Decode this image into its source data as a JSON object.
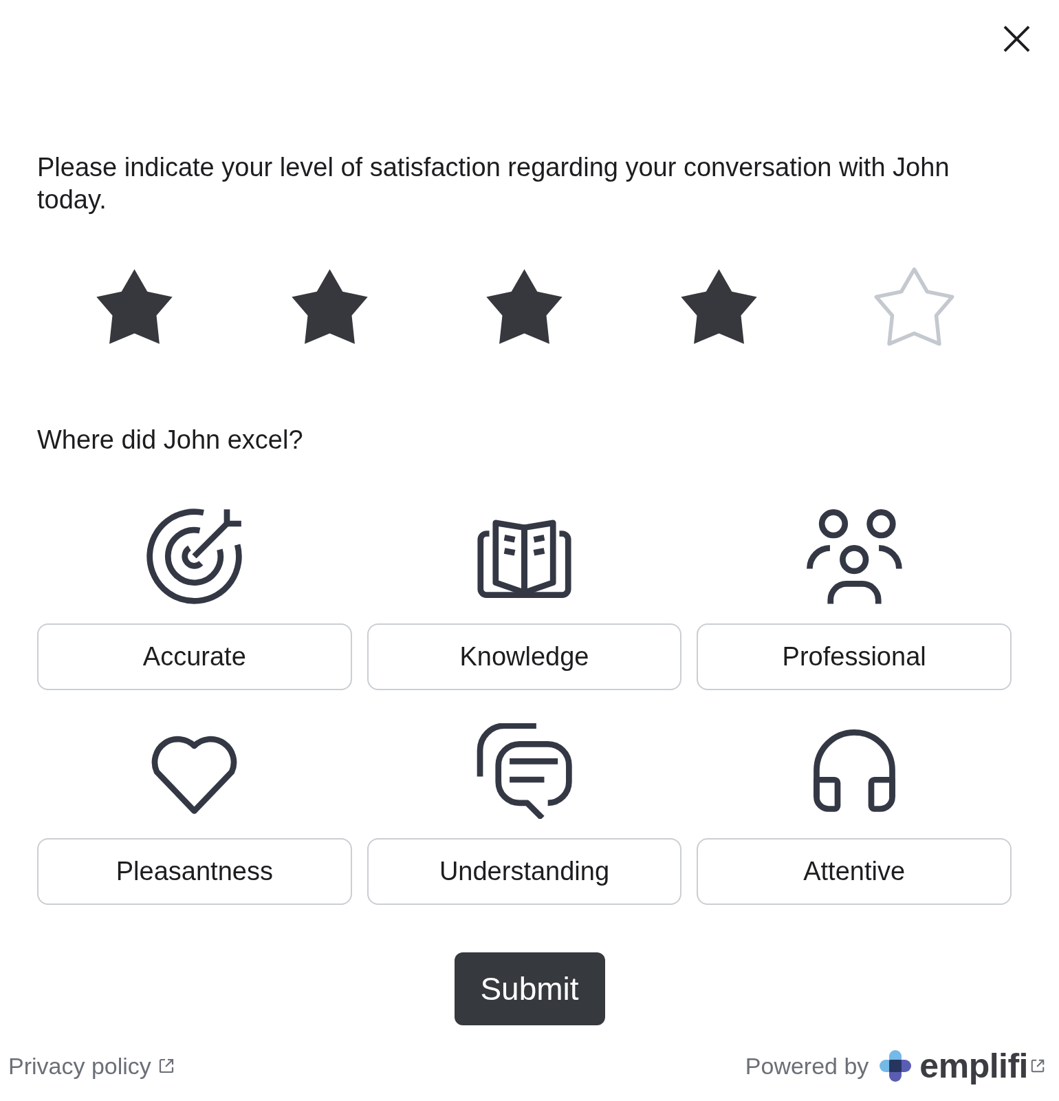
{
  "question": "Please indicate your level of satisfaction regarding your conversation with John today.",
  "rating": {
    "stars": 4
  },
  "excel_prompt": "Where did John excel?",
  "options": [
    {
      "label": "Accurate",
      "selected": false
    },
    {
      "label": "Knowledge",
      "selected": false
    },
    {
      "label": "Professional",
      "selected": false
    },
    {
      "label": "Pleasantness",
      "selected": false
    },
    {
      "label": "Understanding",
      "selected": false
    },
    {
      "label": "Attentive",
      "selected": false
    }
  ],
  "submit_button": {
    "label": "Submit"
  },
  "footer": {
    "privacy_link": "Privacy policy",
    "powered_by": "Powered by",
    "brand": "emplifi"
  }
}
